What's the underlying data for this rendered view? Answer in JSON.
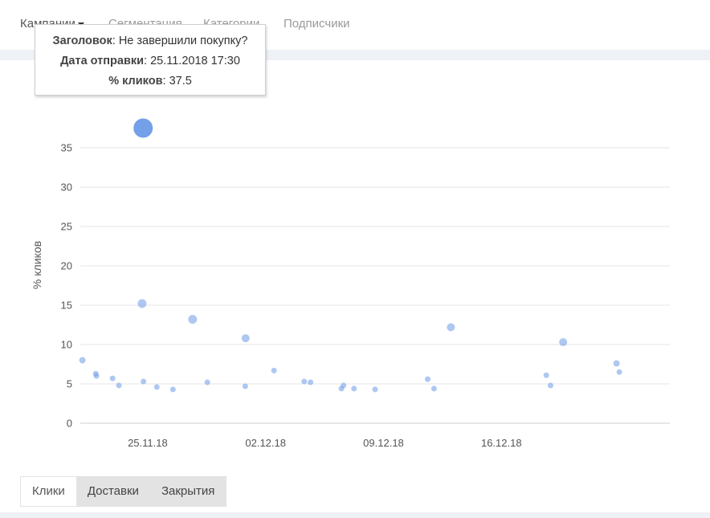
{
  "nav": {
    "items": [
      {
        "label": "Кампании",
        "active": true,
        "has_dropdown": true
      },
      {
        "label": "Сегментация",
        "active": false
      },
      {
        "label": "Категории",
        "active": false
      },
      {
        "label": "Подписчики",
        "active": false
      }
    ]
  },
  "tooltip": {
    "title_label": "Заголовок",
    "title_value": "Не завершили покупку?",
    "date_label": "Дата отправки",
    "date_value": "25.11.2018 17:30",
    "clicks_label": "% кликов",
    "clicks_value": "37.5"
  },
  "chart_data": {
    "type": "scatter",
    "ylabel": "% кликов",
    "xlabel": "",
    "ylim": [
      0,
      40
    ],
    "yticks": [
      0,
      5,
      10,
      15,
      20,
      25,
      30,
      35
    ],
    "x_range": [
      "2018-11-21",
      "2018-12-26"
    ],
    "xticks": [
      {
        "date": "2018-11-25",
        "label": "25.11.18"
      },
      {
        "date": "2018-12-02",
        "label": "02.12.18"
      },
      {
        "date": "2018-12-09",
        "label": "09.12.18"
      },
      {
        "date": "2018-12-16",
        "label": "16.12.18"
      }
    ],
    "grid": true,
    "point_color": "#6c9be6",
    "highlight_color": "#6c9be6",
    "points": [
      {
        "x": "2018-11-21 03:00",
        "y": 8.0,
        "size": 4
      },
      {
        "x": "2018-11-21 22:00",
        "y": 6.3,
        "size": 3.5
      },
      {
        "x": "2018-11-21 23:00",
        "y": 6.0,
        "size": 3.5
      },
      {
        "x": "2018-11-22 22:00",
        "y": 5.7,
        "size": 3.5
      },
      {
        "x": "2018-11-23 07:00",
        "y": 4.8,
        "size": 3.5
      },
      {
        "x": "2018-11-24 16:00",
        "y": 15.2,
        "size": 5.5
      },
      {
        "x": "2018-11-24 17:30",
        "y": 37.5,
        "size": 12,
        "highlight": true
      },
      {
        "x": "2018-11-24 18:00",
        "y": 5.3,
        "size": 3.5
      },
      {
        "x": "2018-11-25 13:00",
        "y": 4.6,
        "size": 3.5
      },
      {
        "x": "2018-11-26 12:00",
        "y": 4.3,
        "size": 3.5
      },
      {
        "x": "2018-11-27 16:00",
        "y": 13.2,
        "size": 5.5
      },
      {
        "x": "2018-11-28 13:00",
        "y": 5.2,
        "size": 3.5
      },
      {
        "x": "2018-11-30 19:00",
        "y": 4.7,
        "size": 3.5
      },
      {
        "x": "2018-11-30 19:30",
        "y": 10.8,
        "size": 5
      },
      {
        "x": "2018-12-02 12:00",
        "y": 6.7,
        "size": 3.5
      },
      {
        "x": "2018-12-04 07:00",
        "y": 5.3,
        "size": 3.5
      },
      {
        "x": "2018-12-04 16:00",
        "y": 5.2,
        "size": 3.5
      },
      {
        "x": "2018-12-06 12:00",
        "y": 4.4,
        "size": 3.5
      },
      {
        "x": "2018-12-06 15:00",
        "y": 4.8,
        "size": 3.5
      },
      {
        "x": "2018-12-07 06:00",
        "y": 4.4,
        "size": 3.5
      },
      {
        "x": "2018-12-08 12:00",
        "y": 4.3,
        "size": 3.5
      },
      {
        "x": "2018-12-11 15:00",
        "y": 5.6,
        "size": 3.5
      },
      {
        "x": "2018-12-12 00:00",
        "y": 4.4,
        "size": 3.5
      },
      {
        "x": "2018-12-13 00:00",
        "y": 12.2,
        "size": 5
      },
      {
        "x": "2018-12-18 16:00",
        "y": 6.1,
        "size": 3.5
      },
      {
        "x": "2018-12-18 22:00",
        "y": 4.8,
        "size": 3.5
      },
      {
        "x": "2018-12-19 16:00",
        "y": 10.3,
        "size": 5
      },
      {
        "x": "2018-12-22 20:00",
        "y": 7.6,
        "size": 4
      },
      {
        "x": "2018-12-23 00:00",
        "y": 6.5,
        "size": 3.5
      }
    ]
  },
  "tabs": [
    {
      "label": "Клики",
      "active": true
    },
    {
      "label": "Доставки",
      "active": false
    },
    {
      "label": "Закрытия",
      "active": false
    }
  ]
}
